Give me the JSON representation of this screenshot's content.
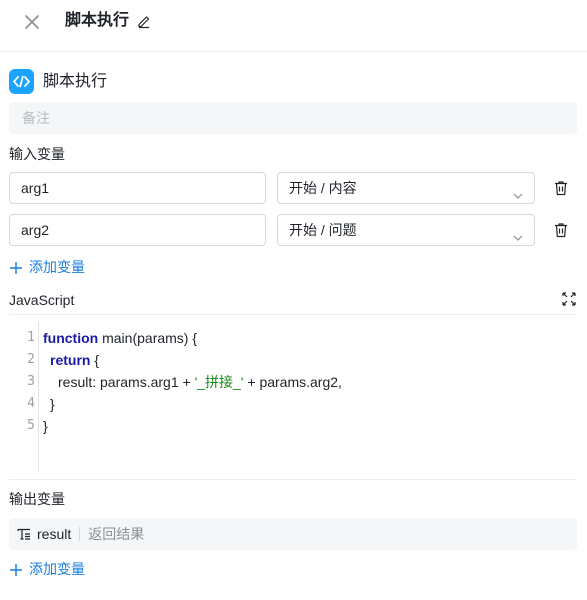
{
  "header": {
    "title": "脚本执行"
  },
  "node": {
    "title": "脚本执行"
  },
  "remark": {
    "placeholder": "备注"
  },
  "inputs": {
    "label": "输入变量",
    "variables": [
      {
        "name": "arg1",
        "source": "开始 / 内容"
      },
      {
        "name": "arg2",
        "source": "开始 / 问题"
      }
    ],
    "add_label": "添加变量"
  },
  "code": {
    "language": "JavaScript",
    "lines": [
      {
        "n": "1",
        "kw": "function",
        "rest": " main(params) {"
      },
      {
        "n": "2",
        "kw": "return",
        "rest": " {"
      },
      {
        "n": "3",
        "pre": "result: params.arg1 + ",
        "str": "'_拼接_'",
        "post": " + params.arg2,"
      },
      {
        "n": "4",
        "rest": "}"
      },
      {
        "n": "5",
        "rest": "}"
      }
    ]
  },
  "outputs": {
    "label": "输出变量",
    "items": [
      {
        "name": "result",
        "description": "返回结果"
      }
    ],
    "add_label": "添加变量"
  },
  "colors": {
    "accent": "#1a7fe0",
    "node_icon": "#1aa3ff",
    "keyword": "#1a1aa6",
    "string": "#1a8a1a"
  }
}
